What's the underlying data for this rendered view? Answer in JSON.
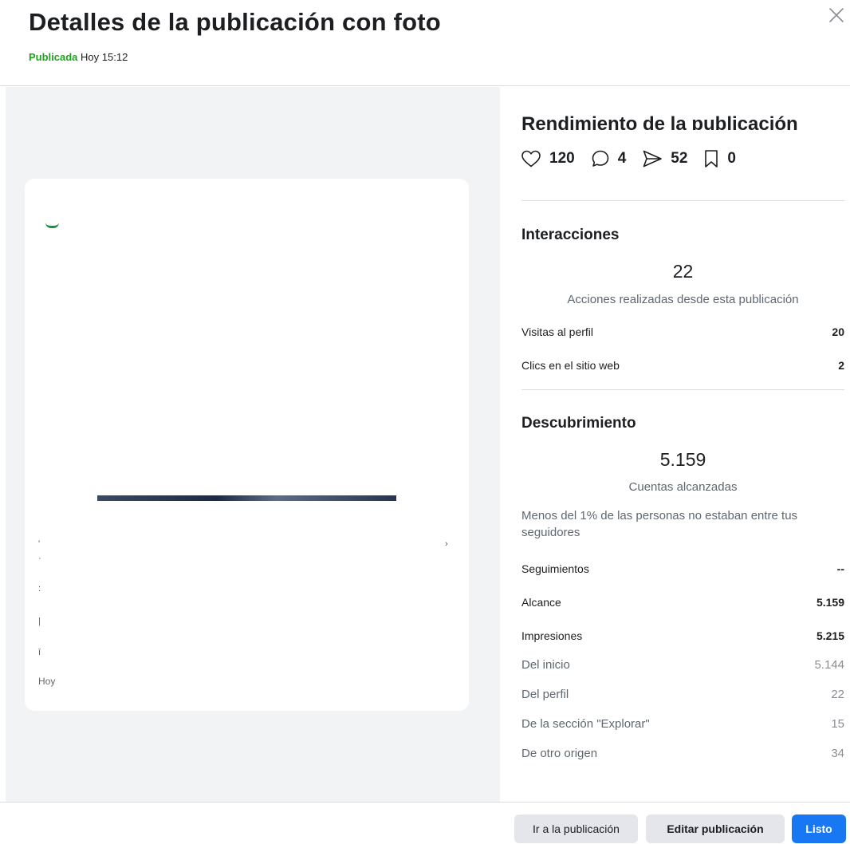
{
  "header": {
    "title": "Detalles de la publicación con foto",
    "status": "Publicada",
    "time": "Hoy 15:12"
  },
  "preview": {
    "time": "Hoy"
  },
  "performance": {
    "title": "Rendimiento de la publicación",
    "likes": "120",
    "comments": "4",
    "shares": "52",
    "saves": "0"
  },
  "interactions": {
    "title": "Interacciones",
    "total": "22",
    "subtitle": "Acciones realizadas desde esta publicación",
    "rows": [
      {
        "label": "Visitas al perfil",
        "value": "20"
      },
      {
        "label": "Clics en el sitio web",
        "value": "2"
      }
    ]
  },
  "discovery": {
    "title": "Descubrimiento",
    "total": "5.159",
    "subtitle": "Cuentas alcanzadas",
    "note": "Menos del 1% de las personas no estaban entre tus seguidores",
    "rows": [
      {
        "label": "Seguimientos",
        "value": "--"
      },
      {
        "label": "Alcance",
        "value": "5.159"
      },
      {
        "label": "Impresiones",
        "value": "5.215"
      }
    ],
    "impression_sources": [
      {
        "label": "Del inicio",
        "value": "5.144"
      },
      {
        "label": "Del perfil",
        "value": "22"
      },
      {
        "label": "De la sección \"Explorar\"",
        "value": "15"
      },
      {
        "label": "De otro origen",
        "value": "34"
      }
    ]
  },
  "footer": {
    "go_to_post": "Ir a la publicación",
    "edit_post": "Editar publicación",
    "done": "Listo"
  },
  "colors": {
    "published_green": "#1fa31f",
    "primary_blue": "#1877f2",
    "button_gray": "#e4e6eb",
    "panel_gray": "#f2f3f5"
  },
  "icons": [
    "close-icon",
    "heart-icon",
    "comment-icon",
    "share-icon",
    "bookmark-icon"
  ]
}
